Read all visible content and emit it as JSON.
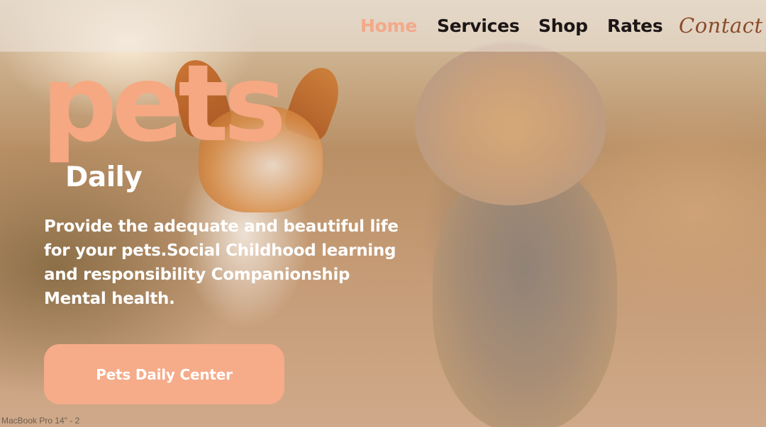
{
  "nav": {
    "items": [
      {
        "label": "Home",
        "active": true
      },
      {
        "label": "Services",
        "active": false
      },
      {
        "label": "Shop",
        "active": false
      },
      {
        "label": "Rates",
        "active": false
      },
      {
        "label": "Contact",
        "active": false
      }
    ]
  },
  "hero": {
    "logo_main": "pets",
    "logo_sub": "Daily",
    "tagline": "Provide the adequate and beautiful life for your pets.Social Childhood learning and responsibility Companionship Mental health.",
    "cta_label": "Pets Daily Center"
  },
  "frame": {
    "label": "MacBook Pro 14\" - 2"
  },
  "colors": {
    "accent": "#f6a882",
    "nav_active": "#f3a98a",
    "nav_text": "#1c1616",
    "contact": "#8a4b2b",
    "button": "#f6ab89"
  }
}
